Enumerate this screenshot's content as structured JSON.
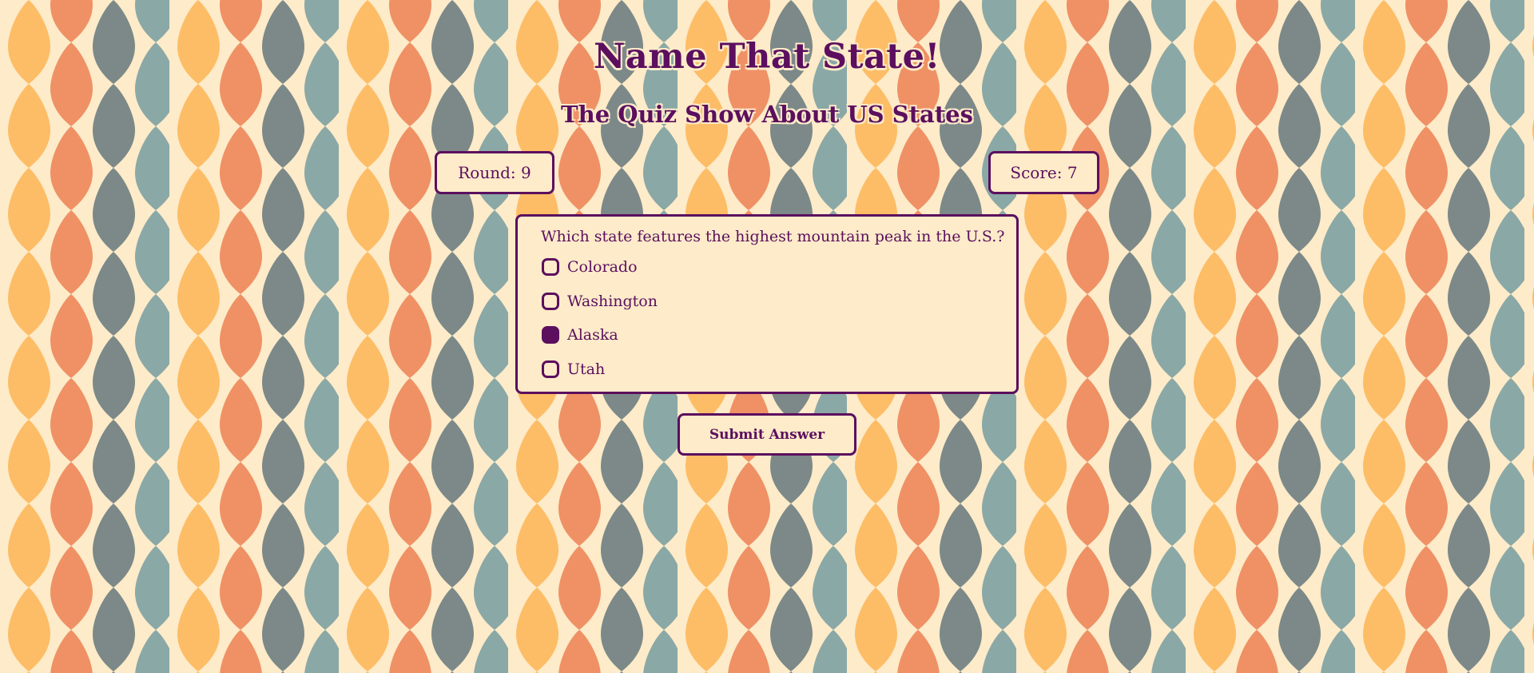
{
  "header": {
    "title": "Name That State!",
    "subtitle": "The Quiz Show About US States"
  },
  "stats": {
    "round_label": "Round: 9",
    "score_label": "Score: 7"
  },
  "quiz": {
    "question": "Which state features the highest mountain peak in the U.S.?",
    "options": [
      {
        "label": "Colorado",
        "selected": false
      },
      {
        "label": "Washington",
        "selected": false
      },
      {
        "label": "Alaska",
        "selected": true
      },
      {
        "label": "Utah",
        "selected": false
      }
    ]
  },
  "actions": {
    "submit_label": "Submit Answer"
  },
  "colors": {
    "accent": "#5b0f5e",
    "panel": "#fdebc9",
    "pattern": [
      "#fdbd66",
      "#ef9165",
      "#8aa8a6",
      "#7c8988"
    ]
  }
}
